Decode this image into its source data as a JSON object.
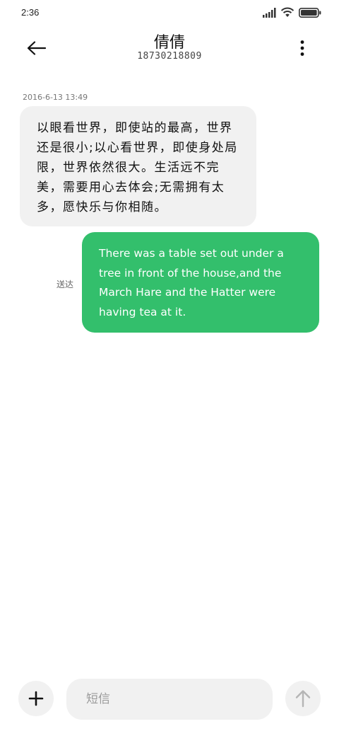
{
  "status_bar": {
    "time": "2:36",
    "icons": [
      "signal-icon",
      "wifi-icon",
      "battery-icon"
    ]
  },
  "header": {
    "back_icon": "arrow-left-icon",
    "contact_name": "倩倩",
    "contact_number": "18730218809",
    "more_icon": "more-vertical-icon"
  },
  "conversation": {
    "timestamp": "2016-6-13 13:49",
    "incoming": {
      "text": "以眼看世界，即使站的最高，世界还是很小;以心看世界，即使身处局限，世界依然很大。生活远不完美，需要用心去体会;无需拥有太多，愿快乐与你相随。"
    },
    "outgoing": {
      "text": "There was a table set out under a tree in front of the house,and the March Hare and the Hatter were having tea at it.",
      "status": "送达"
    }
  },
  "composer": {
    "add_icon": "plus-icon",
    "input_value": "",
    "placeholder": "短信",
    "send_icon": "arrow-up-icon"
  },
  "colors": {
    "outgoing_bubble": "#33bf6c",
    "incoming_bubble": "#f1f1f1",
    "background": "#ffffff"
  }
}
